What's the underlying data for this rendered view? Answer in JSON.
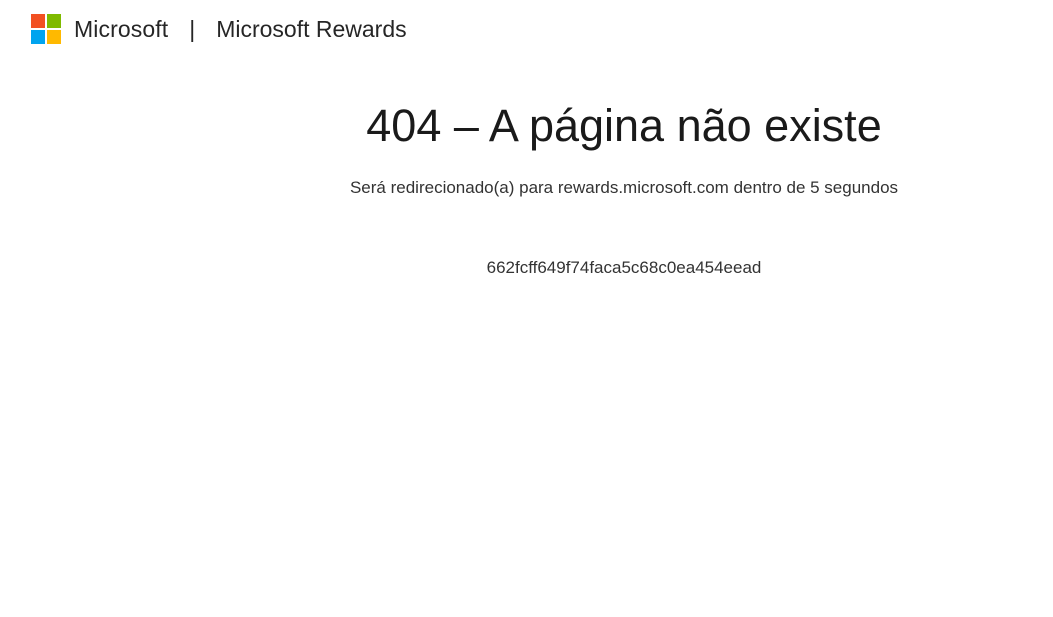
{
  "header": {
    "brand": "Microsoft",
    "separator": "|",
    "product": "Microsoft Rewards",
    "logo_icon": "microsoft-logo-icon",
    "logo_colors": [
      "#f25022",
      "#7fba00",
      "#00a4ef",
      "#ffb900"
    ]
  },
  "error": {
    "title": "404 – A página não existe",
    "redirect_message": "Será redirecionado(a) para rewards.microsoft.com dentro de 5 segundos",
    "error_id": "662fcff649f74faca5c68c0ea454eead"
  }
}
